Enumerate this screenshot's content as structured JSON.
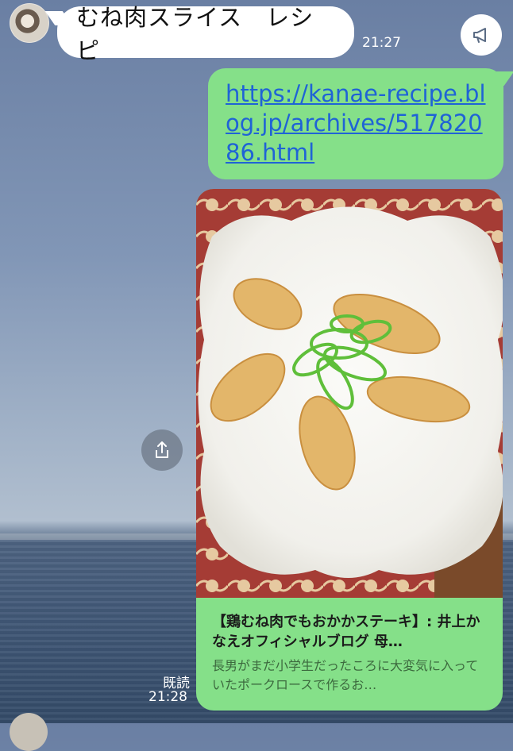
{
  "chat": {
    "incoming": {
      "text": "むね肉スライス　レシピ",
      "time": "21:27"
    },
    "outgoing_link": {
      "url": "https://kanae-recipe.blog.jp/archives/51782086.html"
    },
    "link_preview": {
      "title": "【鶏むね肉でもおかかステーキ】: 井上かなえオフィシャルブログ 母…",
      "description": "長男がまだ小学生だったころに大変気に入っていたポークロースで作るお…"
    },
    "read_status": "既読",
    "outgoing_time": "21:28"
  },
  "icons": {
    "announce": "megaphone-icon",
    "share": "share-upload-icon"
  },
  "colors": {
    "my_bubble": "#85e089",
    "their_bubble": "#ffffff",
    "link": "#1f63d6"
  }
}
